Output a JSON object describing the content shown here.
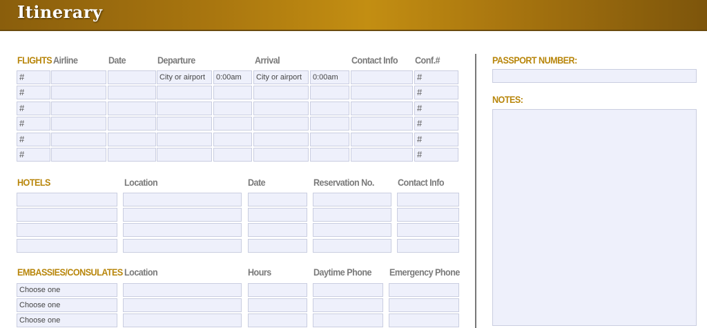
{
  "header": {
    "title": "Itinerary"
  },
  "flights": {
    "section_label": "FLIGHTS",
    "columns": {
      "airline": "Airline",
      "date": "Date",
      "departure": "Departure",
      "arrival": "Arrival",
      "contact": "Contact Info",
      "conf": "Conf.#"
    },
    "rows": [
      {
        "num": "#",
        "dep_city": "City or airport",
        "dep_time": "0:00am",
        "arr_city": "City or airport",
        "arr_time": "0:00am",
        "conf": "#"
      },
      {
        "num": "#",
        "dep_city": "",
        "dep_time": "",
        "arr_city": "",
        "arr_time": "",
        "conf": "#"
      },
      {
        "num": "#",
        "dep_city": "",
        "dep_time": "",
        "arr_city": "",
        "arr_time": "",
        "conf": "#"
      },
      {
        "num": "#",
        "dep_city": "",
        "dep_time": "",
        "arr_city": "",
        "arr_time": "",
        "conf": "#"
      },
      {
        "num": "#",
        "dep_city": "",
        "dep_time": "",
        "arr_city": "",
        "arr_time": "",
        "conf": "#"
      },
      {
        "num": "#",
        "dep_city": "",
        "dep_time": "",
        "arr_city": "",
        "arr_time": "",
        "conf": "#"
      }
    ]
  },
  "hotels": {
    "section_label": "HOTELS",
    "columns": {
      "location": "Location",
      "date": "Date",
      "reservation": "Reservation No.",
      "contact": "Contact Info"
    },
    "row_count": 4
  },
  "embassies": {
    "section_label": "EMBASSIES/CONSULATES",
    "columns": {
      "location": "Location",
      "hours": "Hours",
      "daytime_phone": "Daytime Phone",
      "emergency_phone": "Emergency Phone"
    },
    "rows": [
      {
        "select": "Choose one"
      },
      {
        "select": "Choose one"
      },
      {
        "select": "Choose one"
      }
    ]
  },
  "sidebar": {
    "passport_label": "PASSPORT NUMBER:",
    "notes_label": "NOTES:"
  },
  "colors": {
    "accent": "#b8860b",
    "header": "#a9760f",
    "field_bg": "#eef0fb",
    "field_border": "#c9cde0"
  }
}
